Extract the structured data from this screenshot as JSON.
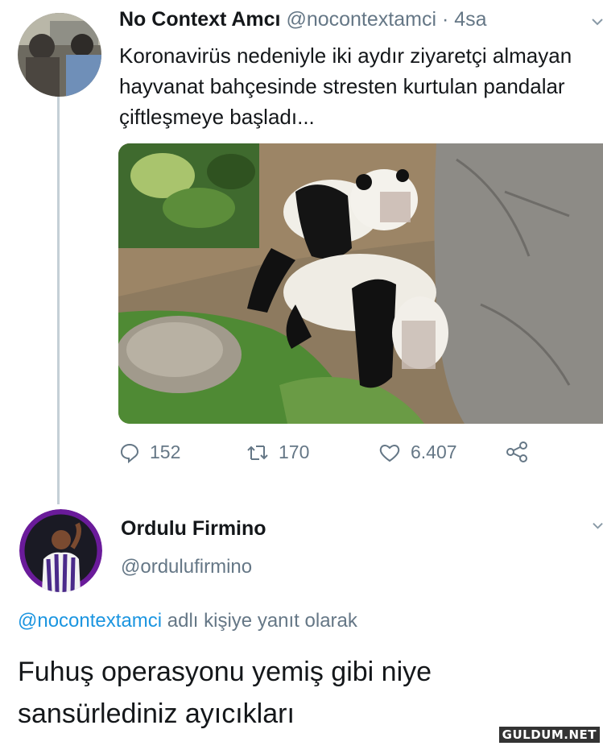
{
  "tweet": {
    "author_name": "No Context Amcı",
    "author_handle": "@nocontextamci",
    "separator": "·",
    "time": "4sa",
    "text": "Koronavirüs nedeniyle iki aydır ziyaretçi almayan hayvanat bahçesinde stresten kurtulan pandalar çiftleşmeye başladı...",
    "media_icon": "panda-photo",
    "actions": {
      "replies": "152",
      "retweets": "170",
      "likes": "6.407",
      "reply_icon": "comment-icon",
      "retweet_icon": "retweet-icon",
      "like_icon": "heart-icon",
      "share_icon": "share-icon"
    }
  },
  "reply": {
    "author_name": "Ordulu Firmino",
    "author_handle": "@ordulufirmino",
    "reply_mention": "@nocontextamci",
    "reply_suffix": " adlı kişiye yanıt olarak",
    "text": "Fuhuş operasyonu yemiş gibi niye sansürlediniz ayıcıkları"
  },
  "watermark": "GULDUM.NET",
  "colors": {
    "text_primary": "#14171a",
    "text_secondary": "#657786",
    "link": "#1b95e0",
    "thread_line": "#c4cfd6",
    "avatar_ring": "#6a1b9a"
  }
}
